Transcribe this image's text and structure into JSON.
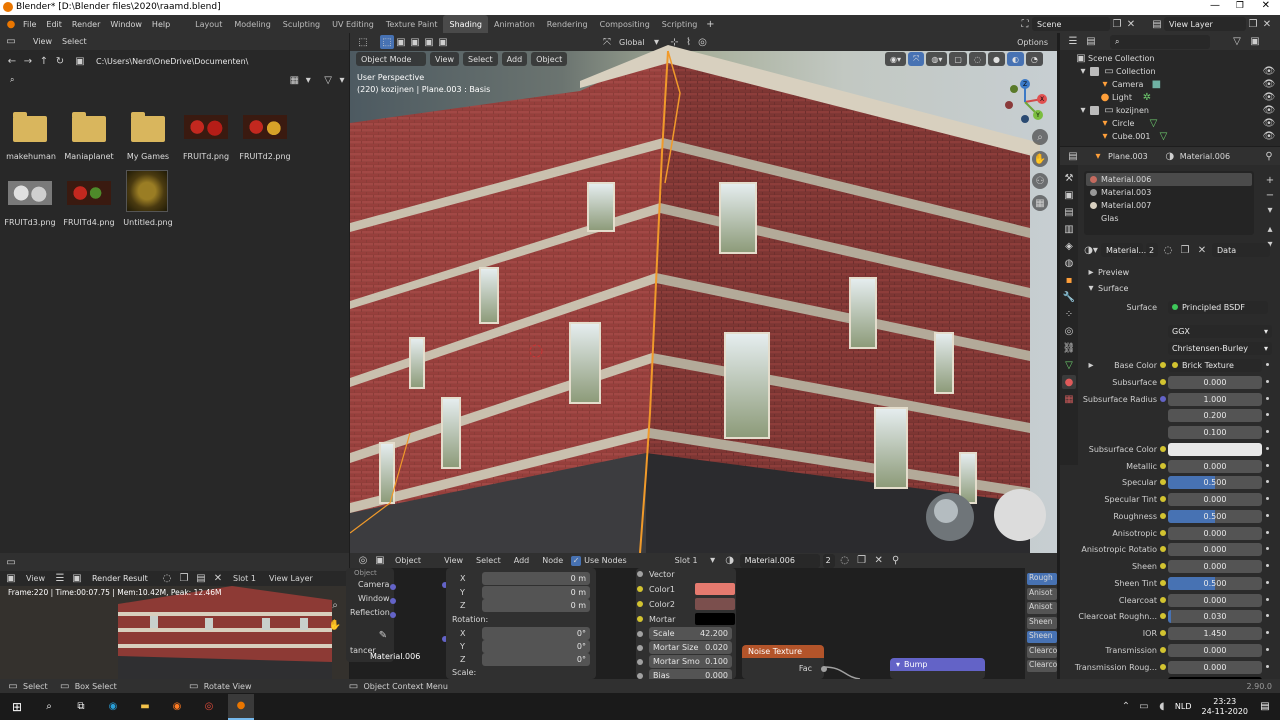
{
  "window": {
    "title": "Blender* [D:\\Blender files\\2020\\raamd.blend]"
  },
  "menu": [
    "File",
    "Edit",
    "Render",
    "Window",
    "Help"
  ],
  "workspaces": [
    "Layout",
    "Modeling",
    "Sculpting",
    "UV Editing",
    "Texture Paint",
    "Shading",
    "Animation",
    "Rendering",
    "Compositing",
    "Scripting"
  ],
  "active_workspace": "Shading",
  "scene": "Scene",
  "view_layer": "View Layer",
  "filebrowser": {
    "view": "View",
    "select": "Select",
    "path": "C:\\Users\\Nerd\\OneDrive\\Documenten\\",
    "items": [
      "makehuman",
      "Maniaplanet",
      "My Games",
      "FRUITd.png",
      "FRUITd2.png",
      "FRUITd3.png",
      "FRUITd4.png",
      "Untitled.png"
    ]
  },
  "viewport": {
    "mode": "Object Mode",
    "menus": [
      "View",
      "Select",
      "Add",
      "Object"
    ],
    "orientation": "Global",
    "options": "Options",
    "info_line1": "User Perspective",
    "info_line2": "(220) kozijnen | Plane.003 : Basis",
    "gizmo": {
      "x": "X",
      "y": "Y",
      "z": "Z"
    }
  },
  "render": {
    "view": "View",
    "image": "Render Result",
    "slot": "Slot 1",
    "layer": "View Layer",
    "stats": "Frame:220 | Time:00:07.75 | Mem:10.42M, Peak: 12.46M"
  },
  "nodes": {
    "menus": [
      "View",
      "Select",
      "Add",
      "Node"
    ],
    "type": "Object",
    "use_nodes": "Use Nodes",
    "slot": "Slot 1",
    "material": "Material.006",
    "users": "2",
    "left_labels": [
      "Object",
      "Camera",
      "Window",
      "Reflection"
    ],
    "tancer": "tancer",
    "loc": {
      "x": "X",
      "y": "Y",
      "z": "Z",
      "x_v": "0 m",
      "y_v": "0 m",
      "z_v": "0 m"
    },
    "rotation": "Rotation:",
    "rot": {
      "x_v": "0°",
      "y_v": "0°",
      "z_v": "0°"
    },
    "scale_label": "Scale:",
    "brick": {
      "vector": "Vector",
      "color1": "Color1",
      "color2": "Color2",
      "mortar": "Mortar",
      "scale": "Scale",
      "scale_v": "42.200",
      "mortar_size": "Mortar Size",
      "mortar_size_v": "0.020",
      "mortar_smooth": "Mortar Smo",
      "mortar_smooth_v": "0.100",
      "bias": "Bias",
      "bias_v": "0.000"
    },
    "noise_texture": "Noise Texture",
    "fac": "Fac",
    "bump": "Bump",
    "normal": "Normal",
    "right_sockets": [
      "Rough",
      "Anisot",
      "Anisot",
      "Sheen",
      "Sheen",
      "Clearco",
      "Clearco",
      "IOR"
    ],
    "node_material": "Material.006"
  },
  "outliner": {
    "title": "Scene Collection",
    "items": [
      {
        "name": "Collection"
      },
      {
        "name": "Camera"
      },
      {
        "name": "Light"
      },
      {
        "name": "kozijnen"
      },
      {
        "name": "Circle"
      },
      {
        "name": "Cube.001"
      }
    ]
  },
  "properties": {
    "object": "Plane.003",
    "material": "Material.006",
    "slots": [
      "Material.006",
      "Material.003",
      "Material.007",
      "Glas"
    ],
    "mat_name": "Material...",
    "mat_users": "2",
    "data": "Data",
    "preview": "Preview",
    "surface": "Surface",
    "surface_label": "Surface",
    "surface_value": "Principled BSDF",
    "distribution": "GGX",
    "subsurface_method": "Christensen-Burley",
    "fields": [
      {
        "label": "Base Color",
        "value": "Brick Texture",
        "link": true
      },
      {
        "label": "Subsurface",
        "value": "0.000",
        "fill": 0
      },
      {
        "label": "Subsurface Radius",
        "value": "1.000",
        "fill": 0
      },
      {
        "label": "",
        "value": "0.200",
        "fill": 0
      },
      {
        "label": "",
        "value": "0.100",
        "fill": 0
      },
      {
        "label": "Subsurface Color",
        "value": "",
        "color": "#e8e8e8"
      },
      {
        "label": "Metallic",
        "value": "0.000",
        "fill": 0
      },
      {
        "label": "Specular",
        "value": "0.500",
        "fill": 0.5
      },
      {
        "label": "Specular Tint",
        "value": "0.000",
        "fill": 0
      },
      {
        "label": "Roughness",
        "value": "0.500",
        "fill": 0.5
      },
      {
        "label": "Anisotropic",
        "value": "0.000",
        "fill": 0
      },
      {
        "label": "Anisotropic Rotatio",
        "value": "0.000",
        "fill": 0
      },
      {
        "label": "Sheen",
        "value": "0.000",
        "fill": 0
      },
      {
        "label": "Sheen Tint",
        "value": "0.500",
        "fill": 0.5
      },
      {
        "label": "Clearcoat",
        "value": "0.000",
        "fill": 0
      },
      {
        "label": "Clearcoat Roughn...",
        "value": "0.030",
        "fill": 0.03
      },
      {
        "label": "IOR",
        "value": "1.450",
        "fill": 0
      },
      {
        "label": "Transmission",
        "value": "0.000",
        "fill": 0
      },
      {
        "label": "Transmission Roug...",
        "value": "0.000",
        "fill": 0
      },
      {
        "label": "Emission",
        "value": "",
        "color": "#000000"
      }
    ]
  },
  "status": {
    "select": "Select",
    "box_select": "Box Select",
    "rotate": "Rotate View",
    "context": "Object Context Menu",
    "version": "2.90.0"
  },
  "taskbar": {
    "time": "23:23",
    "date": "24-11-2020",
    "lang": "NLD"
  },
  "colors": {
    "accent": "#4772b3",
    "selection": "#f19a2a",
    "brick_color1": "#e57a6f",
    "brick_color2": "#7b4f4d"
  }
}
